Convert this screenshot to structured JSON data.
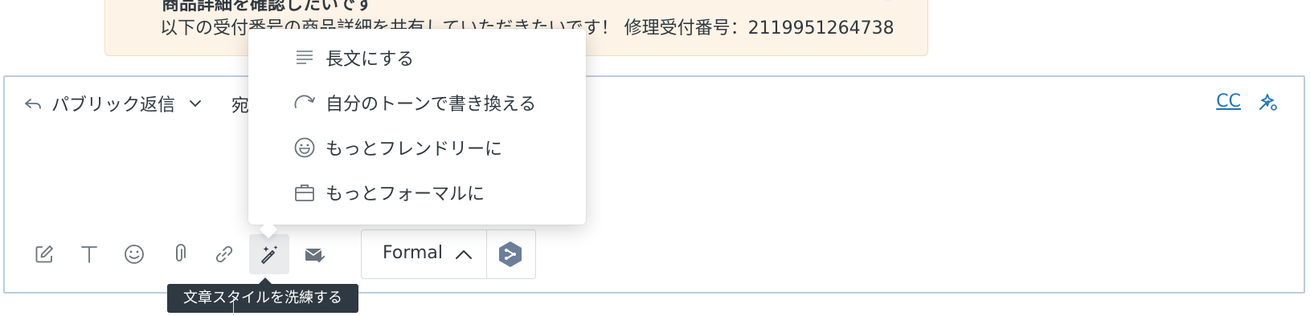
{
  "message": {
    "title": "商品詳細を確認したいです",
    "text": "以下の受付番号の商品詳細を共有していただきたいです！ 修理受付番号：2119951264738"
  },
  "editor": {
    "reply_mode": "パブリック返信",
    "to_label": "宛",
    "cc_label": "CC"
  },
  "toolbar": {
    "buttons": [
      "compose-icon",
      "text-format-icon",
      "emoji-icon",
      "attachment-icon",
      "link-icon",
      "magic-wand-icon",
      "email-check-icon"
    ],
    "tone_select": "Formal"
  },
  "tooltip": {
    "text": "文章スタイルを洗練する"
  },
  "menu": {
    "items": [
      {
        "label": "長文にする",
        "icon": "lines-icon"
      },
      {
        "label": "自分のトーンで書き換える",
        "icon": "rewrite-arrow-icon"
      },
      {
        "label": "もっとフレンドリーに",
        "icon": "smiley-icon"
      },
      {
        "label": "もっとフォーマルに",
        "icon": "briefcase-icon"
      }
    ]
  },
  "colors": {
    "accent": "#1f73b7",
    "text": "#2f3941",
    "card_bg": "#fdf3e7",
    "tooltip_bg": "#2f3941"
  }
}
